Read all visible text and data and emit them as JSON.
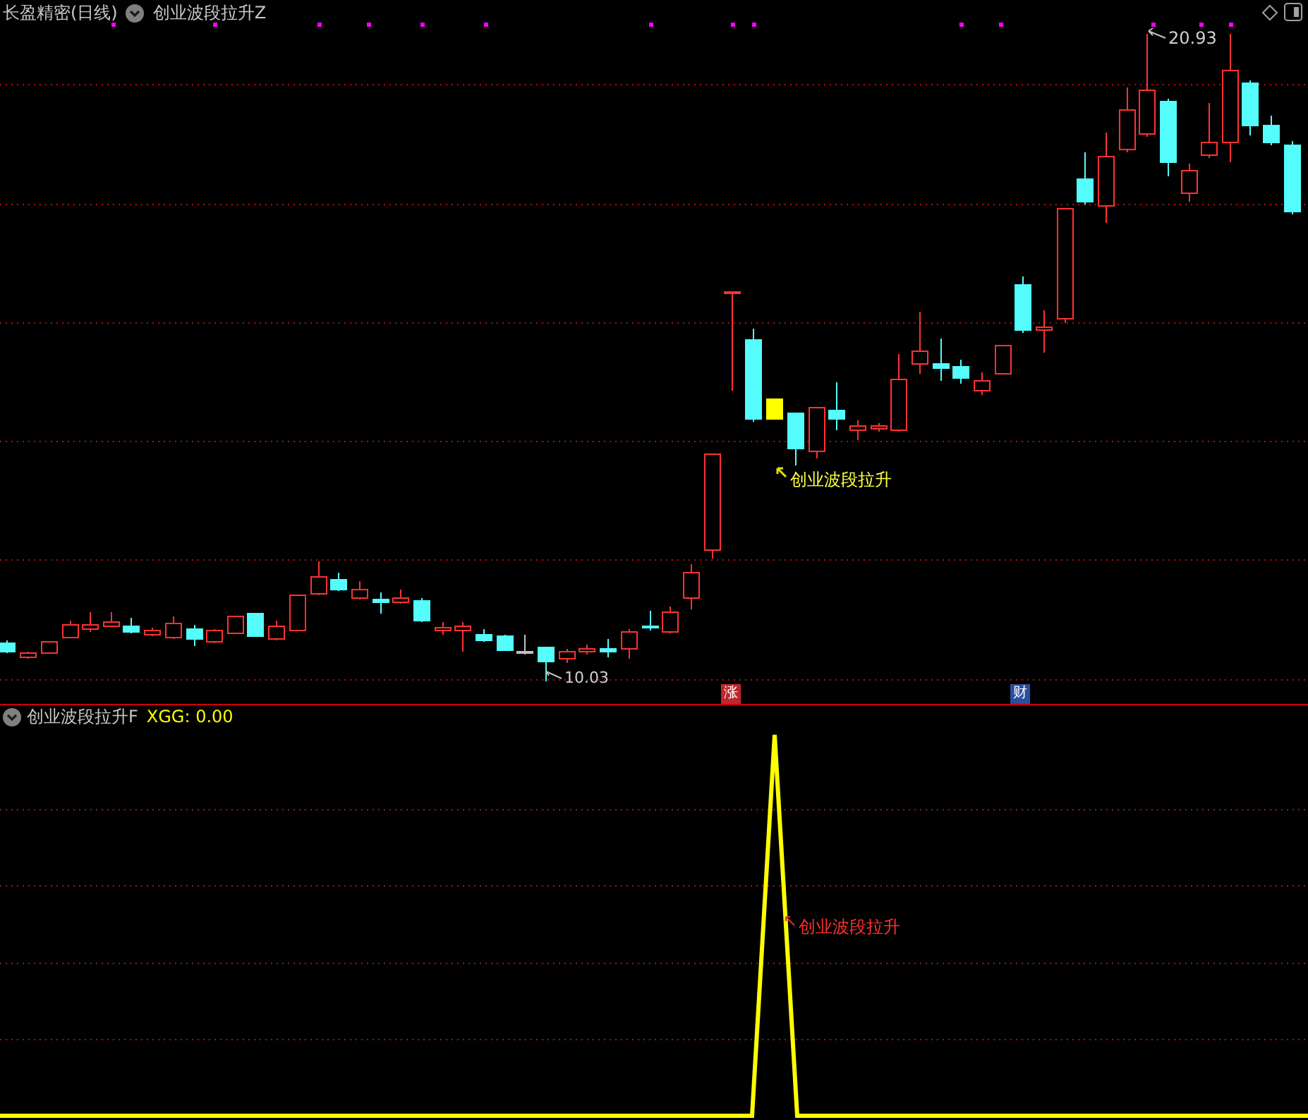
{
  "main_panel": {
    "title": "长盈精密(日线)",
    "indicator": "创业波段拉升Z",
    "high_label": "20.93",
    "low_label": "10.03",
    "signal_label": "创业波段拉升",
    "markers": [
      {
        "text": "涨",
        "color": "#c0262d"
      },
      {
        "text": "财",
        "color": "#2a4f9e"
      }
    ]
  },
  "sub_panel": {
    "title": "创业波段拉升F",
    "reading": "XGG: 0.00",
    "signal_label": "创业波段拉升"
  }
}
